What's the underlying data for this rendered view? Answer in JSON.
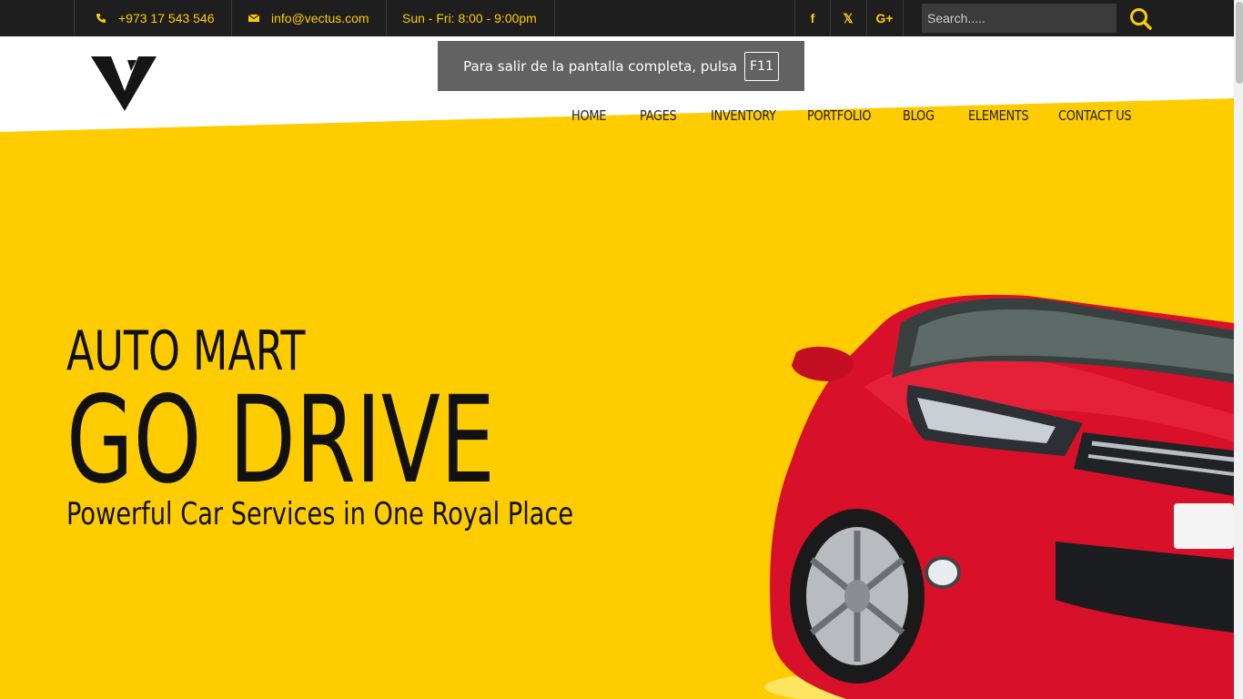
{
  "topbar": {
    "phone": "+973 17 543 546",
    "email": "info@vectus.com",
    "hours": "Sun - Fri: 8:00 - 9:00pm",
    "social": [
      {
        "label": "f",
        "icon": "facebook-icon"
      },
      {
        "label": "𝕏",
        "icon": "x-twitter-icon"
      },
      {
        "label": "G+",
        "icon": "google-plus-icon"
      }
    ],
    "search_placeholder": "Search....."
  },
  "nav": [
    "HOME",
    "PAGES",
    "INVENTORY",
    "PORTFOLIO",
    "BLOG",
    "ELEMENTS",
    "CONTACT US"
  ],
  "fullscreen_notice": {
    "text": "Para salir de la pantalla completa, pulsa",
    "key": "F11"
  },
  "hero": {
    "eyebrow": "AUTO MART",
    "title": "GO DRIVE",
    "subtitle": "Powerful Car Services in One Royal Place"
  },
  "colors": {
    "accent": "#ffcc00",
    "topbar": "#1e1e1e",
    "car": "#d8102a"
  }
}
